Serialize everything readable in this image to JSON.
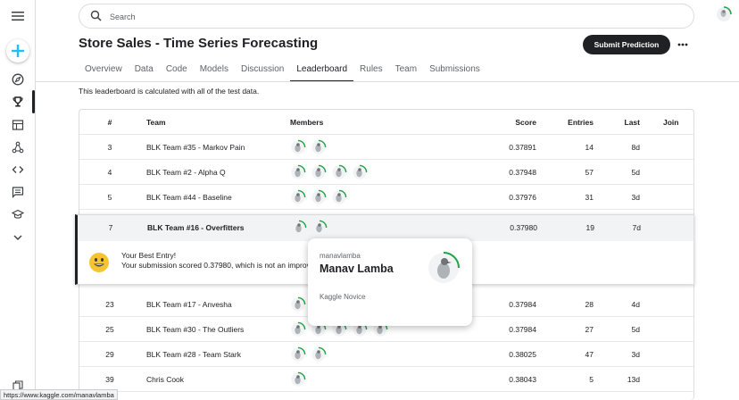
{
  "search": {
    "placeholder": "Search"
  },
  "competition": {
    "title": "Store Sales - Time Series Forecasting",
    "submit_label": "Submit Prediction"
  },
  "tabs": [
    {
      "label": "Overview"
    },
    {
      "label": "Data"
    },
    {
      "label": "Code"
    },
    {
      "label": "Models"
    },
    {
      "label": "Discussion"
    },
    {
      "label": "Leaderboard",
      "active": true
    },
    {
      "label": "Rules"
    },
    {
      "label": "Team"
    },
    {
      "label": "Submissions"
    }
  ],
  "leaderboard": {
    "note": "This leaderboard is calculated with all of the test data.",
    "headers": {
      "rank": "#",
      "team": "Team",
      "members": "Members",
      "score": "Score",
      "entries": "Entries",
      "last": "Last",
      "join": "Join"
    },
    "rows_top": [
      {
        "rank": "3",
        "team": "BLK Team #35 - Markov Pain",
        "members": 2,
        "score": "0.37891",
        "entries": "14",
        "last": "8d"
      },
      {
        "rank": "4",
        "team": "BLK Team #2 - Alpha Q",
        "members": 4,
        "score": "0.37948",
        "entries": "57",
        "last": "5d"
      },
      {
        "rank": "5",
        "team": "BLK Team #44 - Baseline",
        "members": 3,
        "score": "0.37976",
        "entries": "31",
        "last": "3d"
      }
    ],
    "my_row": {
      "rank": "7",
      "team": "BLK Team #16 - Overfitters",
      "members": 2,
      "score": "0.37980",
      "entries": "19",
      "last": "7d"
    },
    "best_entry": {
      "title": "Your Best Entry!",
      "message": "Your submission scored 0.37980, which is not an improvement of your previous score. Keep trying!"
    },
    "rows_bottom": [
      {
        "rank": "23",
        "team": "BLK Team #17 - Anvesha",
        "members": 2,
        "score": "0.37984",
        "entries": "28",
        "last": "4d"
      },
      {
        "rank": "25",
        "team": "BLK Team #30 - The Outliers",
        "members": 5,
        "score": "0.37984",
        "entries": "27",
        "last": "5d"
      },
      {
        "rank": "29",
        "team": "BLK Team #28 - Team Stark",
        "members": 2,
        "score": "0.38025",
        "entries": "47",
        "last": "3d"
      },
      {
        "rank": "39",
        "team": "Chris Cook",
        "members": 1,
        "score": "0.38043",
        "entries": "5",
        "last": "13d"
      }
    ]
  },
  "hovercard": {
    "username": "manavlamba",
    "display_name": "Manav Lamba",
    "tier": "Kaggle Novice"
  },
  "statusbar": {
    "url": "https://www.kaggle.com/manavlamba"
  },
  "colors": {
    "accent": "#20beff",
    "progress_ring": "#1ea446",
    "dark": "#202124"
  }
}
